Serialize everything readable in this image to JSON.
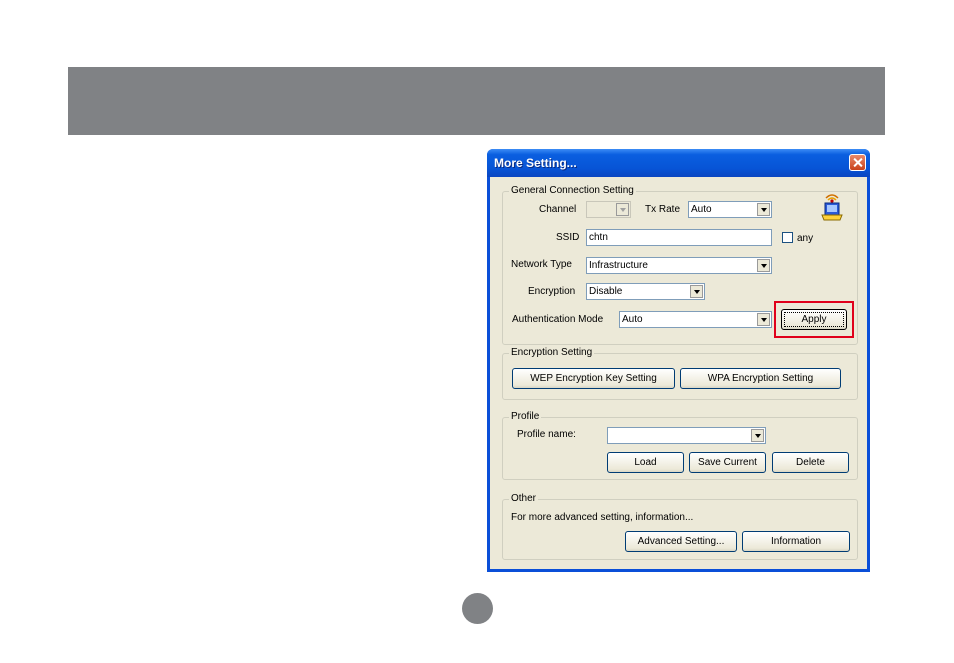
{
  "window": {
    "title": "More Setting..."
  },
  "general": {
    "legend": "General Connection Setting",
    "channel_label": "Channel",
    "channel_value": "",
    "txrate_label": "Tx Rate",
    "txrate_value": "Auto",
    "ssid_label": "SSID",
    "ssid_value": "chtn",
    "any_label": "any",
    "network_type_label": "Network Type",
    "network_type_value": "Infrastructure",
    "encryption_label": "Encryption",
    "encryption_value": "Disable",
    "auth_mode_label": "Authentication Mode",
    "auth_mode_value": "Auto",
    "apply_label": "Apply"
  },
  "encryption": {
    "legend": "Encryption Setting",
    "wep_label": "WEP Encryption Key Setting",
    "wpa_label": "WPA Encryption Setting"
  },
  "profile": {
    "legend": "Profile",
    "name_label": "Profile name:",
    "name_value": "",
    "load_label": "Load",
    "save_label": "Save Current",
    "delete_label": "Delete"
  },
  "other": {
    "legend": "Other",
    "description": "For more advanced setting, information...",
    "advanced_label": "Advanced Setting...",
    "information_label": "Information"
  },
  "colors": {
    "banner": "#808285",
    "highlight": "#e0001b",
    "titlebar": "#0754d6"
  },
  "icons": [
    "close-icon",
    "wireless-adapter-icon",
    "dropdown-arrow-icon"
  ]
}
